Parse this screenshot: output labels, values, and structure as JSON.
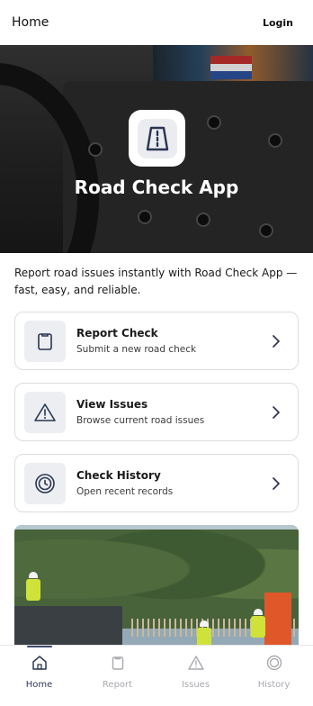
{
  "header": {
    "title": "Home",
    "login_label": "Login"
  },
  "hero": {
    "app_name": "Road Check App",
    "app_icon": "road-icon",
    "flag_colors": [
      "#c8322f",
      "#ffffff",
      "#2f55a4"
    ]
  },
  "intro": "Report road issues instantly with Road Check App — fast, easy, and reliable.",
  "cards": [
    {
      "title": "Report Check",
      "subtitle": "Submit a new road check",
      "icon": "clipboard-icon"
    },
    {
      "title": "View Issues",
      "subtitle": "Browse current road issues",
      "icon": "warning-icon"
    },
    {
      "title": "Check History",
      "subtitle": "Open recent records",
      "icon": "history-icon"
    }
  ],
  "tabs": [
    {
      "label": "Home",
      "icon": "home-icon",
      "active": true
    },
    {
      "label": "Report",
      "icon": "clipboard-icon",
      "active": false
    },
    {
      "label": "Issues",
      "icon": "warning-icon",
      "active": false
    },
    {
      "label": "History",
      "icon": "history-icon",
      "active": false
    }
  ],
  "colors": {
    "active_tab": "#2e3a55",
    "inactive_tab": "#a8aaae",
    "card_border": "#dcdde0",
    "icon_tile": "#eceef1"
  }
}
